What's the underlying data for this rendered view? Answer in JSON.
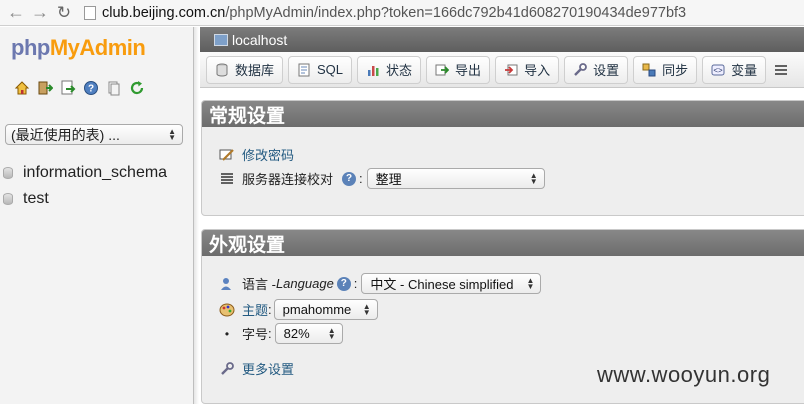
{
  "browser": {
    "url_host": "club.beijing.com.cn",
    "url_rest": "/phpMyAdmin/index.php?token=166dc792b41d608270190434de977bf3"
  },
  "sidebar": {
    "logo_php": "php",
    "logo_my": "My",
    "logo_admin": "Admin",
    "recent_select_value": "(最近使用的表) ...",
    "databases": [
      "information_schema",
      "test"
    ]
  },
  "server_bar": {
    "title": "localhost"
  },
  "tabs": [
    {
      "label": "数据库",
      "icon": "database-icon"
    },
    {
      "label": "SQL",
      "icon": "sql-icon"
    },
    {
      "label": "状态",
      "icon": "status-icon"
    },
    {
      "label": "导出",
      "icon": "export-icon"
    },
    {
      "label": "导入",
      "icon": "import-icon"
    },
    {
      "label": "设置",
      "icon": "settings-icon"
    },
    {
      "label": "同步",
      "icon": "sync-icon"
    },
    {
      "label": "变量",
      "icon": "variables-icon"
    }
  ],
  "general": {
    "title": "常规设置",
    "change_password": "修改密码",
    "collation_label": "服务器连接校对",
    "collation_value": "整理"
  },
  "appearance": {
    "title": "外观设置",
    "language_label": "语言 - ",
    "language_label_en": "Language",
    "language_value": "中文 - Chinese simplified",
    "theme_label": "主题",
    "theme_value": "pmahomme",
    "font_label": "字号",
    "font_value": "82%",
    "more_settings": "更多设置"
  },
  "watermark": "www.wooyun.org",
  "colors": {
    "link": "#235a81",
    "header_grey": "#6c6c6c",
    "logo_orange": "#f89c0e",
    "logo_blue": "#6c78af"
  }
}
